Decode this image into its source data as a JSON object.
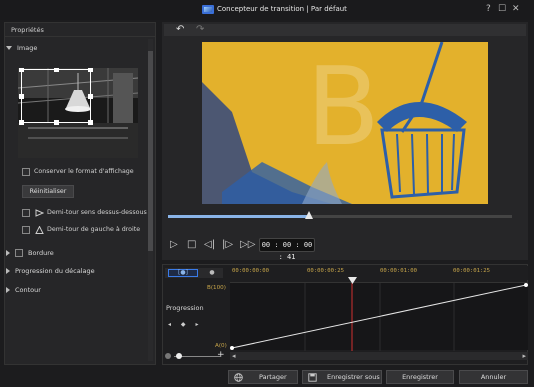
{
  "window": {
    "title": "Concepteur de transition  |  Par défaut",
    "help_glyph": "?",
    "maximize_glyph": "☐",
    "close_glyph": "✕"
  },
  "left_panel": {
    "header": "Propriétés",
    "sections": {
      "image": "Image",
      "border": "Bordure",
      "offset_progress": "Progression du décalage",
      "outline": "Contour"
    },
    "keep_aspect_label": "Conserver le format d'affichage",
    "reset_label": "Réinitialiser",
    "flip_vertical_label": "Demi-tour sens dessus-dessous",
    "flip_horizontal_label": "Demi-tour de gauche à droite"
  },
  "preview": {
    "undo_glyph": "↶",
    "redo_glyph": "↷",
    "stage_letter": "B",
    "seek_progress": 0.41,
    "timecode": "00 : 00 : 00 : 41",
    "controls": {
      "play": "▷",
      "stop": "□",
      "prev_frame": "◁|",
      "next_frame": "|▷",
      "fast_forward": "▷▷"
    }
  },
  "timeline": {
    "tab_keyframe": "[●]",
    "tab_record": "●",
    "ticks": [
      "00:00:00:00",
      "00:00:00:25",
      "00:00:01:00",
      "00:00:01:25"
    ],
    "track_label": "Progression",
    "top_value": "B(100)",
    "bottom_value": "A(0)",
    "keyframe_nav": "◂ ◆ ▸",
    "zoom_plus": "+"
  },
  "footer": {
    "share": "Partager",
    "save_as": "Enregistrer sous",
    "save": "Enregistrer",
    "cancel": "Annuler"
  },
  "colors": {
    "accent": "#3a7be8",
    "stage_bg": "#e3b12c",
    "stage_blue": "#2d5fa8",
    "tick_label": "#c8a64a",
    "playhead": "#d03030"
  }
}
